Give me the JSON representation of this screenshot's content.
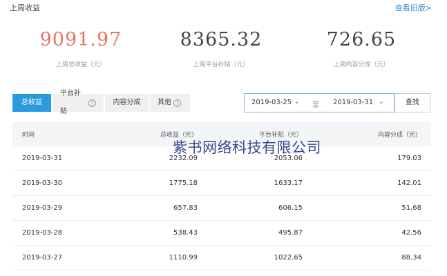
{
  "header": {
    "title": "上周收益",
    "old_version_link": "查看旧版>"
  },
  "stats": [
    {
      "value": "9091.97",
      "label": "上周总收益（元）"
    },
    {
      "value": "8365.32",
      "label": "上周平台补贴（元）"
    },
    {
      "value": "726.65",
      "label": "上周内容分成（元）"
    }
  ],
  "tabs": [
    {
      "label": "总收益",
      "active": true
    },
    {
      "label": "平台补贴",
      "help": "?"
    },
    {
      "label": "内容分成"
    },
    {
      "label": "其他",
      "help": "?"
    }
  ],
  "date_range": {
    "start": "2019-03-25",
    "separator": "至",
    "end": "2019-03-31",
    "search_label": "查找"
  },
  "table": {
    "columns": [
      "时间",
      "总收益（元）",
      "平台补贴（元）",
      "内容分成（元）"
    ],
    "rows": [
      [
        "2019-03-31",
        "2232.09",
        "2053.06",
        "179.03"
      ],
      [
        "2019-03-30",
        "1775.18",
        "1633.17",
        "142.01"
      ],
      [
        "2019-03-29",
        "657.83",
        "606.15",
        "51.68"
      ],
      [
        "2019-03-28",
        "538.43",
        "495.87",
        "42.56"
      ],
      [
        "2019-03-27",
        "1110.99",
        "1022.65",
        "88.34"
      ]
    ]
  },
  "watermark": "紫书网络科技有限公司",
  "colors": {
    "accent": "#2b9be0",
    "highlight_value": "#e8735e",
    "link": "#3f8fd8",
    "watermark": "#2b3d8e"
  }
}
